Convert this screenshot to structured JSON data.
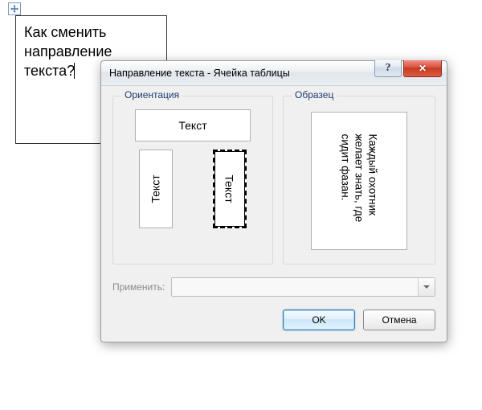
{
  "doc_cell": {
    "text": "Как сменить направление текста?"
  },
  "dialog": {
    "title": "Направление текста - Ячейка таблицы",
    "help_label": "?",
    "close_label": "✕",
    "group_orientation": "Ориентация",
    "group_sample": "Образец",
    "orient_horizontal": "Текст",
    "orient_vertical_left": "Текст",
    "orient_vertical_right": "Текст",
    "sample_text": "Каждый охотник желает знать, где сидит фазан.",
    "apply_label": "Применить:",
    "apply_value": "",
    "ok": "OK",
    "cancel": "Отмена"
  }
}
